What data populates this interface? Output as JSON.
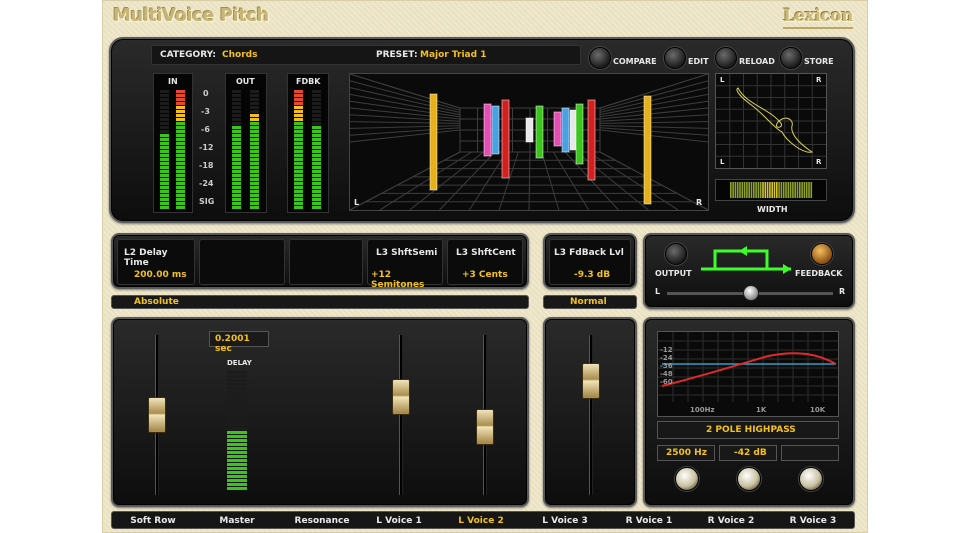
{
  "app": {
    "title": "MultiVoice Pitch",
    "brand": "Lexicon"
  },
  "header": {
    "category_label": "CATEGORY:",
    "category_value": "Chords",
    "preset_label": "PRESET:",
    "preset_value": "Major Triad 1",
    "buttons": {
      "compare": "COMPARE",
      "edit": "EDIT",
      "reload": "RELOAD",
      "store": "STORE"
    }
  },
  "meters": {
    "in_label": "IN",
    "out_label": "OUT",
    "fdbk_label": "FDBK",
    "scale": [
      "0",
      "-3",
      "-6",
      "-12",
      "-18",
      "-24",
      "SIG"
    ]
  },
  "stage": {
    "left": "L",
    "right": "R"
  },
  "scope": {
    "left": "L",
    "right": "R",
    "width_label": "WIDTH"
  },
  "params": {
    "l2_delay": {
      "label": "L2 Delay Time",
      "value": "200.00 ms"
    },
    "l3_semi": {
      "label": "L3 ShftSemi",
      "value": "+12 Semitones"
    },
    "l3_cent": {
      "label": "L3 ShftCent",
      "value": "+3 Cents"
    },
    "l3_fb": {
      "label": "L3 FdBack Lvl",
      "value": "-9.3 dB"
    },
    "mode_left": "Absolute",
    "mode_right": "Normal"
  },
  "routing": {
    "output": "OUTPUT",
    "feedback": "FEEDBACK",
    "l": "L",
    "r": "R"
  },
  "delay": {
    "value": "0.2001 sec",
    "label": "DELAY"
  },
  "filter": {
    "db_scale": [
      "-12",
      "-24",
      "-36",
      "-48",
      "-60"
    ],
    "freq_scale": [
      "100Hz",
      "1K",
      "10K"
    ],
    "type": "2 POLE HIGHPASS",
    "freq": "2500 Hz",
    "gain": "-42 dB"
  },
  "tabs": [
    "Soft Row",
    "Master",
    "Resonance",
    "L Voice 1",
    "L Voice 2",
    "L Voice 3",
    "R Voice 1",
    "R Voice 2",
    "R Voice 3"
  ],
  "colors": {
    "accent": "#f3c21b",
    "green": "#38d11a",
    "red": "#d21f1f"
  }
}
